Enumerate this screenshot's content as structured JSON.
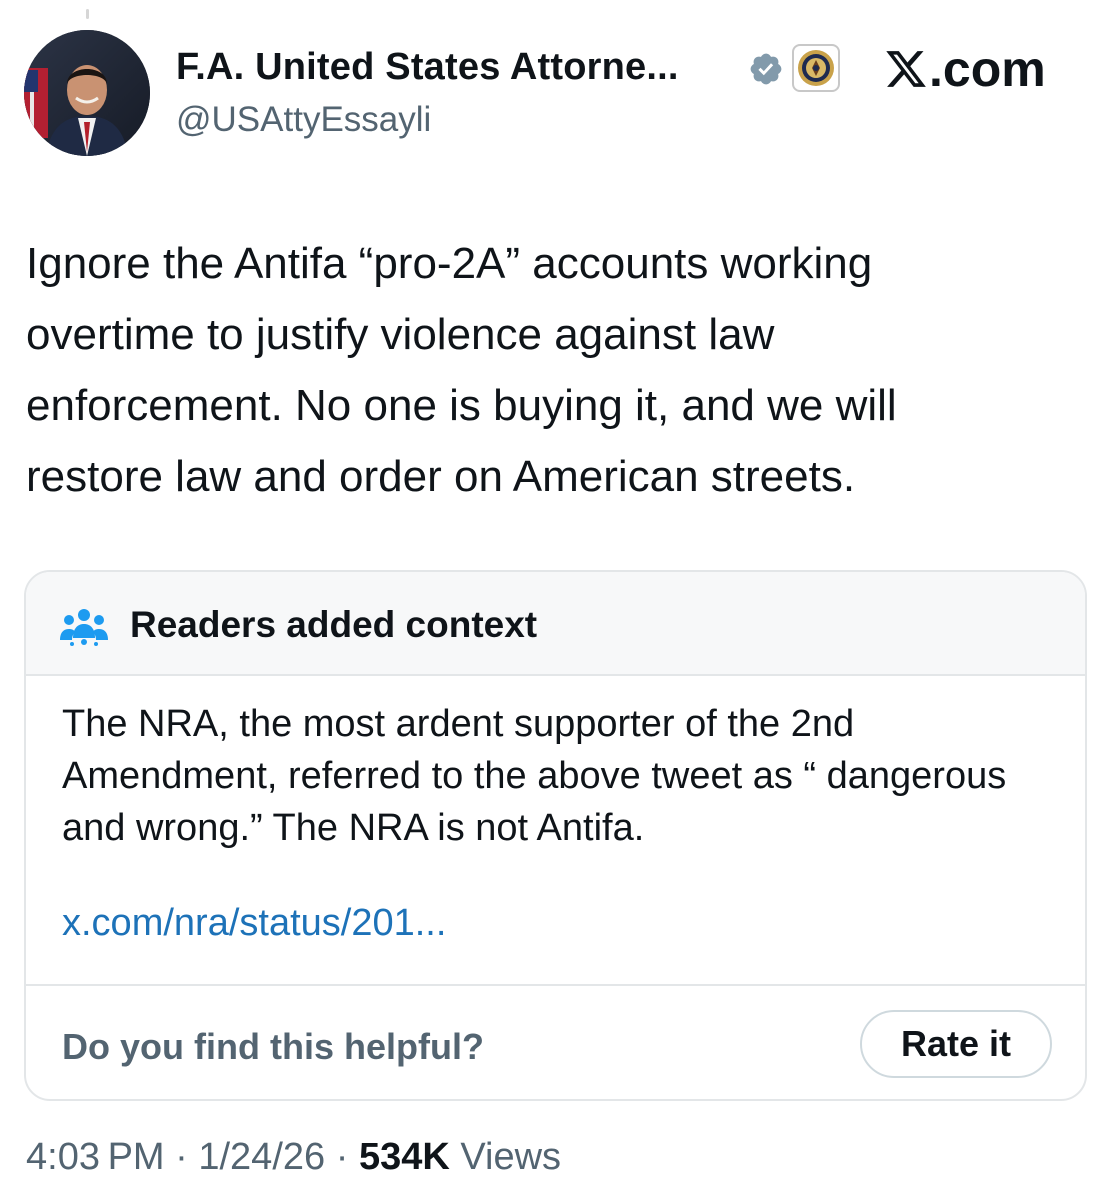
{
  "author": {
    "display_name": "F.A. United States Attorne...",
    "handle": "@USAttyEssayli"
  },
  "brand": {
    "label": ".com",
    "icon": "x-logo-icon"
  },
  "icons": {
    "verified": "verified-badge-icon",
    "affiliate": "doj-seal-icon",
    "note": "people-icon"
  },
  "tweet": {
    "text": "Ignore the Antifa “pro-2A” accounts working overtime to justify violence against law enforcement. No one is buying it, and we will restore law and order on American streets."
  },
  "community_note": {
    "title": "Readers added context",
    "body": "The NRA, the most ardent supporter of the 2nd Amendment, referred to the above tweet as “ dangerous and wrong.” The NRA is not Antifa.",
    "link": "x.com/nra/status/201...",
    "helpful_prompt": "Do you find this helpful?",
    "rate_label": "Rate it"
  },
  "meta": {
    "time": "4:03 PM",
    "date": "1/24/26",
    "separator": "·",
    "views_count": "534K",
    "views_label": "Views"
  },
  "colors": {
    "text": "#0f1419",
    "secondary": "#536471",
    "link": "#1d72b8",
    "verified": "#829aab",
    "note_icon": "#1d9bf0",
    "border": "#e3e6e8"
  }
}
